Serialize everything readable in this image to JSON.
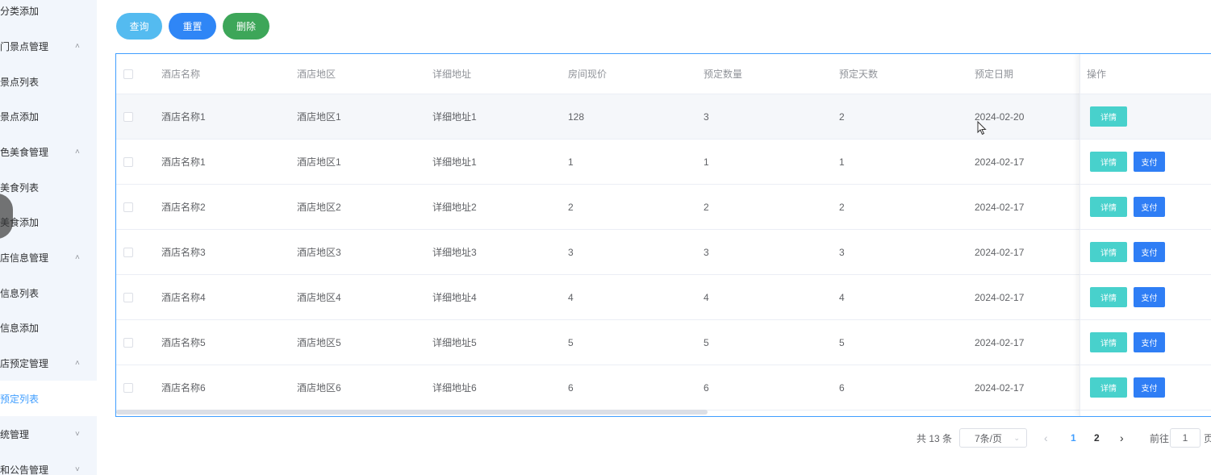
{
  "sidebar": {
    "items": [
      {
        "label": "分类添加",
        "type": "sub",
        "chevron": ""
      },
      {
        "label": "门景点管理",
        "type": "group",
        "chevron": "^"
      },
      {
        "label": "景点列表",
        "type": "sub",
        "chevron": ""
      },
      {
        "label": "景点添加",
        "type": "sub",
        "chevron": ""
      },
      {
        "label": "色美食管理",
        "type": "group",
        "chevron": "^"
      },
      {
        "label": "美食列表",
        "type": "sub",
        "chevron": ""
      },
      {
        "label": "美食添加",
        "type": "sub",
        "chevron": ""
      },
      {
        "label": "店信息管理",
        "type": "group",
        "chevron": "^"
      },
      {
        "label": "信息列表",
        "type": "sub",
        "chevron": ""
      },
      {
        "label": "信息添加",
        "type": "sub",
        "chevron": ""
      },
      {
        "label": "店预定管理",
        "type": "group",
        "chevron": "^"
      },
      {
        "label": "预定列表",
        "type": "active",
        "chevron": ""
      },
      {
        "label": "统管理",
        "type": "group",
        "chevron": "v"
      },
      {
        "label": "和公告管理",
        "type": "group",
        "chevron": "v"
      }
    ]
  },
  "toolbar": {
    "search_label": "查询",
    "reset_label": "重置",
    "delete_label": "删除"
  },
  "table": {
    "columns": [
      "酒店名称",
      "酒店地区",
      "详细地址",
      "房间现价",
      "预定数量",
      "预定天数",
      "预定日期",
      "操作"
    ],
    "rows": [
      {
        "name": "酒店名称1",
        "region": "酒店地区1",
        "address": "详细地址1",
        "price": "128",
        "quantity": "3",
        "days": "2",
        "date": "2024-02-20",
        "detail": "详情",
        "pay": ""
      },
      {
        "name": "酒店名称1",
        "region": "酒店地区1",
        "address": "详细地址1",
        "price": "1",
        "quantity": "1",
        "days": "1",
        "date": "2024-02-17",
        "detail": "详情",
        "pay": "支付"
      },
      {
        "name": "酒店名称2",
        "region": "酒店地区2",
        "address": "详细地址2",
        "price": "2",
        "quantity": "2",
        "days": "2",
        "date": "2024-02-17",
        "detail": "详情",
        "pay": "支付"
      },
      {
        "name": "酒店名称3",
        "region": "酒店地区3",
        "address": "详细地址3",
        "price": "3",
        "quantity": "3",
        "days": "3",
        "date": "2024-02-17",
        "detail": "详情",
        "pay": "支付"
      },
      {
        "name": "酒店名称4",
        "region": "酒店地区4",
        "address": "详细地址4",
        "price": "4",
        "quantity": "4",
        "days": "4",
        "date": "2024-02-17",
        "detail": "详情",
        "pay": "支付"
      },
      {
        "name": "酒店名称5",
        "region": "酒店地区5",
        "address": "详细地址5",
        "price": "5",
        "quantity": "5",
        "days": "5",
        "date": "2024-02-17",
        "detail": "详情",
        "pay": "支付"
      },
      {
        "name": "酒店名称6",
        "region": "酒店地区6",
        "address": "详细地址6",
        "price": "6",
        "quantity": "6",
        "days": "6",
        "date": "2024-02-17",
        "detail": "详情",
        "pay": "支付"
      }
    ]
  },
  "pagination": {
    "total": "共 13 条",
    "page_size": "7条/页",
    "page1": "1",
    "page2": "2",
    "goto_label": "前往",
    "goto_value": "1",
    "page_suffix": "页"
  }
}
